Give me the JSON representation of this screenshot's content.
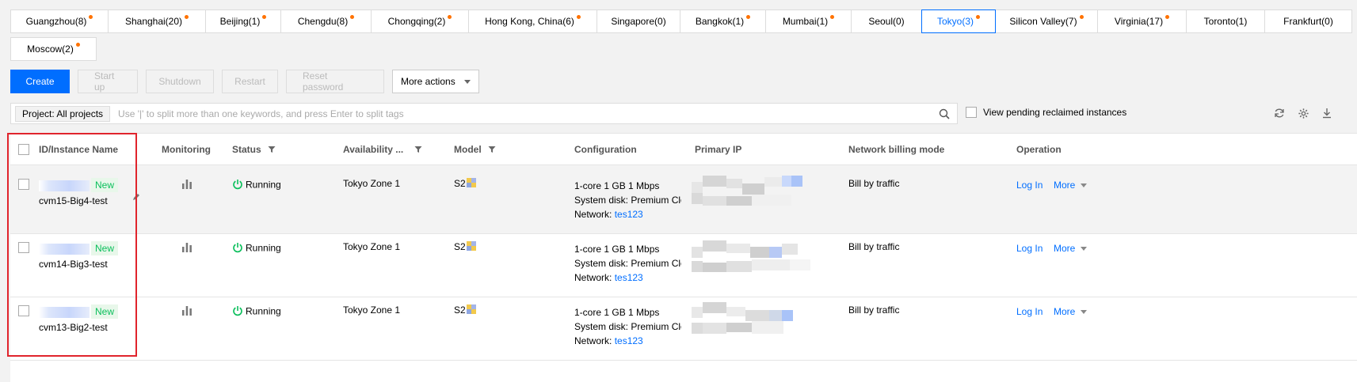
{
  "regions": {
    "row1": [
      {
        "label": "Guangzhou(8)",
        "dot": true,
        "width": 124
      },
      {
        "label": "Shanghai(20)",
        "dot": true,
        "width": 124
      },
      {
        "label": "Beijing(1)",
        "dot": true,
        "width": 96
      },
      {
        "label": "Chengdu(8)",
        "dot": true,
        "width": 115
      },
      {
        "label": "Chongqing(2)",
        "dot": true,
        "width": 124
      },
      {
        "label": "Hong Kong, China(6)",
        "dot": true,
        "width": 163
      },
      {
        "label": "Singapore(0)",
        "dot": false,
        "width": 106
      },
      {
        "label": "Bangkok(1)",
        "dot": true,
        "width": 109
      },
      {
        "label": "Mumbai(1)",
        "dot": true,
        "width": 109
      },
      {
        "label": "Seoul(0)",
        "dot": false,
        "width": 90
      },
      {
        "label": "Tokyo(3)",
        "dot": true,
        "width": 94,
        "active": true
      },
      {
        "label": "Silicon Valley(7)",
        "dot": true,
        "width": 130
      },
      {
        "label": "Virginia(17)",
        "dot": true,
        "width": 113
      },
      {
        "label": "Toronto(1)",
        "dot": false,
        "width": 100
      },
      {
        "label": "Frankfurt(0)",
        "dot": false,
        "width": 111
      }
    ],
    "row2": [
      {
        "label": "Moscow(2)",
        "dot": true,
        "width": 109
      }
    ]
  },
  "actions": {
    "create": "Create",
    "start_up": "Start up",
    "shutdown": "Shutdown",
    "restart": "Restart",
    "reset_password": "Reset password",
    "more_actions": "More actions"
  },
  "search": {
    "project_tag": "Project: All projects",
    "placeholder": "Use '|' to split more than one keywords, and press Enter to split tags",
    "pending_label": "View pending reclaimed instances"
  },
  "table": {
    "headers": {
      "id_name": "ID/Instance Name",
      "monitoring": "Monitoring",
      "status": "Status",
      "availability": "Availability ...",
      "model": "Model",
      "configuration": "Configuration",
      "primary_ip": "Primary IP",
      "billing": "Network billing mode",
      "operation": "Operation"
    },
    "rows": [
      {
        "badge": "New",
        "name": "cvm15-Big4-test",
        "status": "Running",
        "zone": "Tokyo Zone 1",
        "model": "S2",
        "config_line1": "1-core 1 GB 1 Mbps",
        "config_line2": "System disk: Premium Clo",
        "network_label": "Network:",
        "network_value": "tes123",
        "billing": "Bill by traffic",
        "login": "Log In",
        "more": "More"
      },
      {
        "badge": "New",
        "name": "cvm14-Big3-test",
        "status": "Running",
        "zone": "Tokyo Zone 1",
        "model": "S2",
        "config_line1": "1-core 1 GB 1 Mbps",
        "config_line2": "System disk: Premium Clo",
        "network_label": "Network:",
        "network_value": "tes123",
        "billing": "Bill by traffic",
        "login": "Log In",
        "more": "More"
      },
      {
        "badge": "New",
        "name": "cvm13-Big2-test",
        "status": "Running",
        "zone": "Tokyo Zone 1",
        "model": "S2",
        "config_line1": "1-core 1 GB 1 Mbps",
        "config_line2": "System disk: Premium Clo",
        "network_label": "Network:",
        "network_value": "tes123",
        "billing": "Bill by traffic",
        "login": "Log In",
        "more": "More"
      }
    ]
  },
  "colors": {
    "accent": "#006eff",
    "running": "#0abf5b",
    "dot": "#ff7200",
    "highlight_box": "#e0242c"
  }
}
